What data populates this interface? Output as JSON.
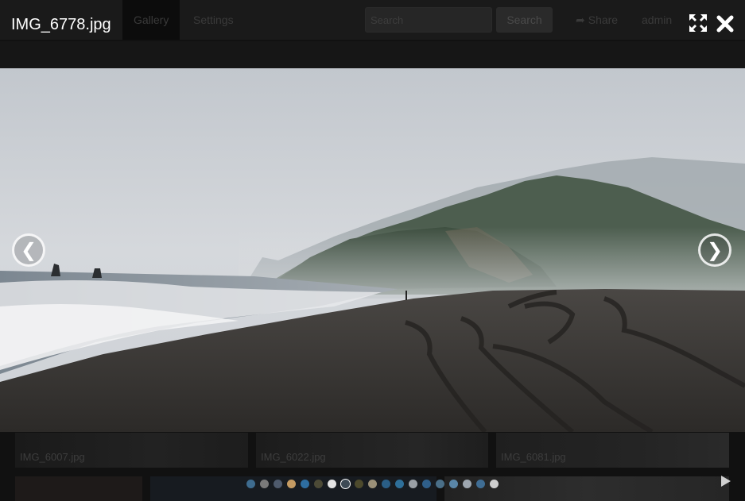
{
  "lightbox": {
    "title": "IMG_6778.jpg",
    "icons": {
      "fullscreen": "fullscreen-icon",
      "close": "close-icon",
      "previous": "chevron-left-icon",
      "next": "chevron-right-icon",
      "play": "play-icon"
    },
    "prev_glyph": "❮",
    "next_glyph": "❯",
    "slide_dots": {
      "count": 20,
      "active_index": 7,
      "colors": [
        "#3e6c8f",
        "#7a7a7a",
        "#4e5a6c",
        "#c59b62",
        "#2e6ea1",
        "#4c4a36",
        "#e4e4e4",
        "#3c4c58",
        "#4d4a2c",
        "#9a9078",
        "#2a5e86",
        "#2e6f99",
        "#9aa0a6",
        "#2f5f8a",
        "#4a6f88",
        "#5a86a8",
        "#9ea7b0",
        "#3f6d94",
        "#cfcfcf"
      ]
    }
  },
  "background_page": {
    "nav_tabs": [
      {
        "label": "Gallery",
        "active": true
      },
      {
        "label": "Settings",
        "active": false
      }
    ],
    "search": {
      "placeholder": "Search",
      "button_label": "Search"
    },
    "share_label": "Share",
    "user_label": "admin",
    "thumbnails": [
      {
        "label": "IMG_6007.jpg"
      },
      {
        "label": "IMG_6022.jpg"
      },
      {
        "label": "IMG_6081.jpg"
      }
    ]
  },
  "colors": {
    "overlay_bg": "#111111",
    "title_text": "#ffffff",
    "sky": "#cfd3d8",
    "sand": "#3a3836"
  }
}
